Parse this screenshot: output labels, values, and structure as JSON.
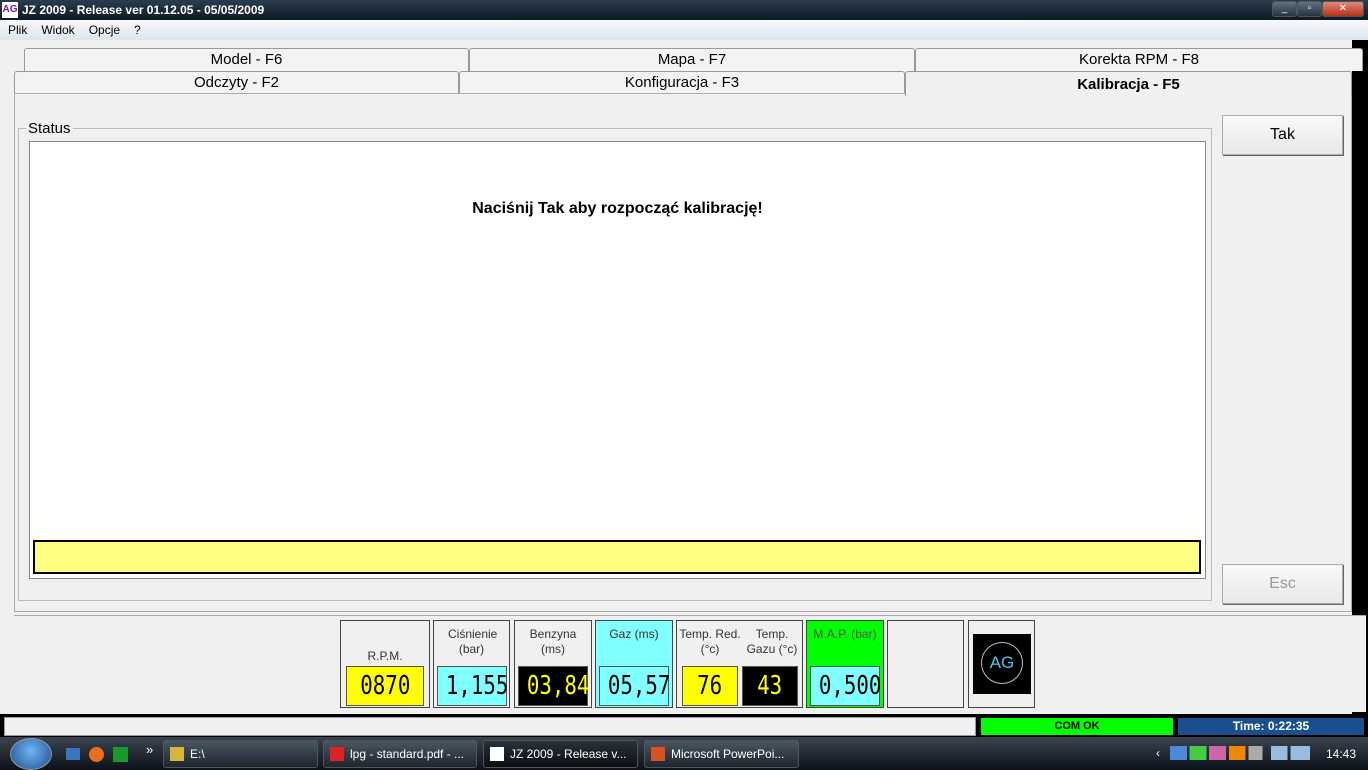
{
  "window": {
    "title": "JZ 2009  - Release  ver 01.12.05 - 05/05/2009",
    "logo": "AG"
  },
  "menu": [
    "Plik",
    "Widok",
    "Opcje",
    "?"
  ],
  "tabs_row1": [
    "Model - F6",
    "Mapa - F7",
    "Korekta RPM - F8"
  ],
  "tabs_row2": [
    "Odczyty - F2",
    "Konfiguracja - F3",
    "Kalibracja - F5"
  ],
  "active_tab": "Kalibracja - F5",
  "status": {
    "label": "Status",
    "message": "Naciśnij Tak aby rozpocząć kalibrację!"
  },
  "buttons": {
    "yes": "Tak",
    "esc": "Esc"
  },
  "gauges": {
    "rpm": {
      "label": "R.P.M.",
      "value": "0870"
    },
    "pressure": {
      "label": "Ciśnienie (bar)",
      "value": "1,155"
    },
    "petrol": {
      "label": "Benzyna (ms)",
      "value": "03,84"
    },
    "gas": {
      "label": "Gaz (ms)",
      "value": "05,57"
    },
    "temp_red": {
      "label": "Temp. Red. (°c)",
      "value": "76"
    },
    "temp_gas": {
      "label": "Temp. Gazu (°c)",
      "value": "43"
    },
    "map": {
      "label": "M.A.P. (bar)",
      "value": "0,500"
    },
    "logo": "AG"
  },
  "statusbar": {
    "com": "COM OK",
    "time": "Time: 0:22:35"
  },
  "taskbar": {
    "tasks": [
      "E:\\",
      "lpg - standard.pdf - ...",
      "JZ 2009  - Release  v...",
      "Microsoft PowerPoi..."
    ],
    "clock": "14:43",
    "overflow": "»"
  },
  "colors": {
    "yellow": "#ffff00",
    "cyan": "#80ffff",
    "green": "#00ff00",
    "black": "#000000",
    "status_blue": "#1a4e8f"
  }
}
